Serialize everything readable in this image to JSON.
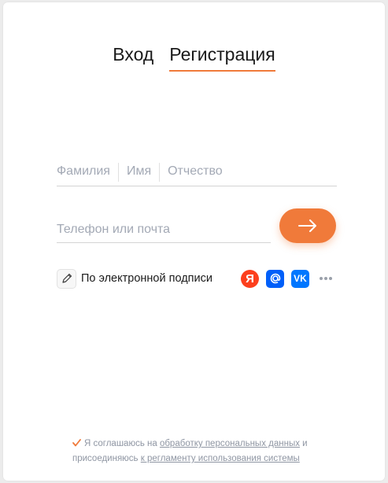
{
  "tabs": [
    {
      "label": "Вход",
      "active": false
    },
    {
      "label": "Регистрация",
      "active": true
    }
  ],
  "form": {
    "surname_placeholder": "Фамилия",
    "name_placeholder": "Имя",
    "patronymic_placeholder": "Отчество",
    "contact_placeholder": "Телефон или почта"
  },
  "esign": {
    "label": "По электронной подписи",
    "icon": "pen-icon"
  },
  "socials": {
    "yandex": {
      "glyph": "Я",
      "icon": "yandex-icon",
      "color": "#fc3f1d"
    },
    "mailru": {
      "icon": "mailru-icon",
      "color": "#005ff9"
    },
    "vk": {
      "glyph": "VK",
      "icon": "vk-icon",
      "color": "#0077ff"
    },
    "more": {
      "icon": "more-icon"
    }
  },
  "consent": {
    "checked": true,
    "text1": "Я соглашаюсь на ",
    "link1": "обработку персональных данных",
    "text2": " и присоединяюсь ",
    "link2": "к регламенту использования системы"
  },
  "colors": {
    "accent": "#f07a3a",
    "placeholder": "#a3a9b5",
    "text": "#1a1a1a"
  }
}
